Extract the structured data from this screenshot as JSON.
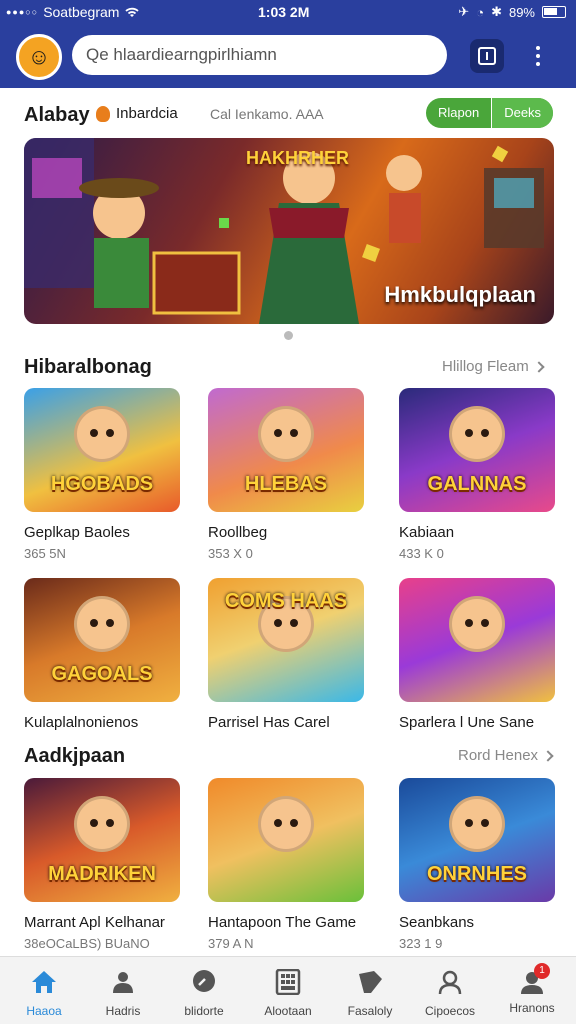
{
  "status_bar": {
    "carrier": "Soatbegram",
    "time": "1:03 2M",
    "battery": "89%"
  },
  "header": {
    "search_text": "Qe hlaardiearngpirlhiamn",
    "logo_icon": "chef-mascot-icon",
    "action_icon": "tablet-icon",
    "menu_icon": "kebab-menu-icon"
  },
  "tabs": {
    "brand": "Alabay",
    "category": "Inbardcia",
    "subtitle": "Cal Ienkamo. AAA",
    "pills": [
      "Rlapon",
      "Deeks"
    ]
  },
  "banner": {
    "headline": "HAKHRHER",
    "caption": "Hmkbulqplaan"
  },
  "section1": {
    "title": "Hibaralbonag",
    "more": "Hlillog Fleam",
    "cards": [
      {
        "title": "Geplkap Baoles",
        "meta": "365 5N",
        "logo": "HGOBADS",
        "bg": "linear-gradient(160deg,#3aa0e8,#f0c040 60%,#e85a2a)"
      },
      {
        "title": "Roollbeg",
        "meta": "353 X 0",
        "logo": "HLEBAS",
        "bg": "linear-gradient(160deg,#c06ad0,#f08a4a 60%,#e8d040)"
      },
      {
        "title": "Kabiaan",
        "meta": "433 K 0",
        "logo": "GALNNAS",
        "bg": "linear-gradient(160deg,#2a2a7a,#8a3ac8 50%,#e84a8a)"
      }
    ]
  },
  "section2": {
    "cards": [
      {
        "title": "Kulaplalnonienos",
        "meta": "",
        "logo": "GAGOALS",
        "bg": "linear-gradient(160deg,#6a2a1a,#d87a2a 50%,#f0b040)"
      },
      {
        "title": "Parrisel Has Carel",
        "meta": "",
        "logo": "COMS HAAS",
        "bg": "linear-gradient(160deg,#f0a030,#f0d070 45%,#3ab8e8)"
      },
      {
        "title": "Sparlera l Une Sane",
        "meta": "",
        "logo": "",
        "bg": "linear-gradient(160deg,#e8408a,#9a3ad8 50%,#f0c040)"
      }
    ]
  },
  "section3": {
    "title": "Aadkjpaan",
    "more": "Rord Henex",
    "cards": [
      {
        "title": "Marrant Apl Kelhanar",
        "meta": "38eOCaLBS) BUaNO",
        "logo": "MADRIKEN",
        "bg": "linear-gradient(160deg,#4a1a3a,#d85a2a 50%,#f0b040)"
      },
      {
        "title": "Hantapoon The Game",
        "meta": "379 A N",
        "logo": "",
        "bg": "linear-gradient(160deg,#f08a2a,#f0c060 50%,#6ac03a)"
      },
      {
        "title": "Seanbkans",
        "meta": "323 1 9",
        "logo": "ONRNHES",
        "bg": "linear-gradient(160deg,#1a4a9a,#3a8ad8 50%,#6a3aa8)"
      }
    ]
  },
  "nav": {
    "items": [
      {
        "label": "Haaoa",
        "icon": "home-icon"
      },
      {
        "label": "Hadris",
        "icon": "people-icon"
      },
      {
        "label": "blidorte",
        "icon": "chat-bubble-icon"
      },
      {
        "label": "Alootaan",
        "icon": "grid-icon"
      },
      {
        "label": "Fasaloly",
        "icon": "tag-icon"
      },
      {
        "label": "Cipoecos",
        "icon": "person-icon"
      },
      {
        "label": "Hranons",
        "icon": "profile-icon"
      }
    ],
    "badge": "1"
  },
  "colors": {
    "header_bg": "#2a3f9e",
    "pill_green": "#4aa63a",
    "active_nav": "#2a8ad8"
  }
}
